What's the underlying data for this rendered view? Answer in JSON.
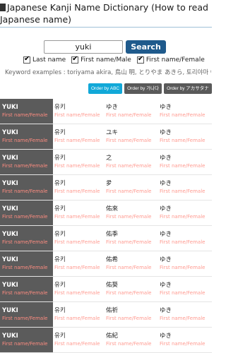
{
  "header": {
    "title": "Japanese Kanji Name Dictionary (How to read Japanese name)"
  },
  "search": {
    "value": "yuki",
    "button_label": "Search"
  },
  "filters": [
    {
      "label": "Last name",
      "checked": true
    },
    {
      "label": "First name/Male",
      "checked": true
    },
    {
      "label": "First name/Female",
      "checked": true
    }
  ],
  "examples": "Keyword examples : toriyama akira, 鳥山 明, とりやま あきら, 토리야마 아키라",
  "order": {
    "abc": "Order by ABC",
    "korean": "Order by 가나다",
    "katakana": "Order by アカサタナ"
  },
  "results": [
    {
      "romaji": "YUKI",
      "type": "First name/Female",
      "korean": "유키",
      "kanji": "ゆき",
      "kana": "ゆき"
    },
    {
      "romaji": "YUKI",
      "type": "First name/Female",
      "korean": "유키",
      "kanji": "ユキ",
      "kana": "ゆき"
    },
    {
      "romaji": "YUKI",
      "type": "First name/Female",
      "korean": "유키",
      "kanji": "之",
      "kana": "ゆき"
    },
    {
      "romaji": "YUKI",
      "type": "First name/Female",
      "korean": "유키",
      "kanji": "夛",
      "kana": "ゆき"
    },
    {
      "romaji": "YUKI",
      "type": "First name/Female",
      "korean": "유키",
      "kanji": "佑來",
      "kana": "ゆき"
    },
    {
      "romaji": "YUKI",
      "type": "First name/Female",
      "korean": "유키",
      "kanji": "佑季",
      "kana": "ゆき"
    },
    {
      "romaji": "YUKI",
      "type": "First name/Female",
      "korean": "유키",
      "kanji": "佑希",
      "kana": "ゆき"
    },
    {
      "romaji": "YUKI",
      "type": "First name/Female",
      "korean": "유키",
      "kanji": "佑葵",
      "kana": "ゆき"
    },
    {
      "romaji": "YUKI",
      "type": "First name/Female",
      "korean": "유키",
      "kanji": "佑祈",
      "kana": "ゆき"
    },
    {
      "romaji": "YUKI",
      "type": "First name/Female",
      "korean": "유키",
      "kanji": "佑紀",
      "kana": "ゆき"
    }
  ]
}
